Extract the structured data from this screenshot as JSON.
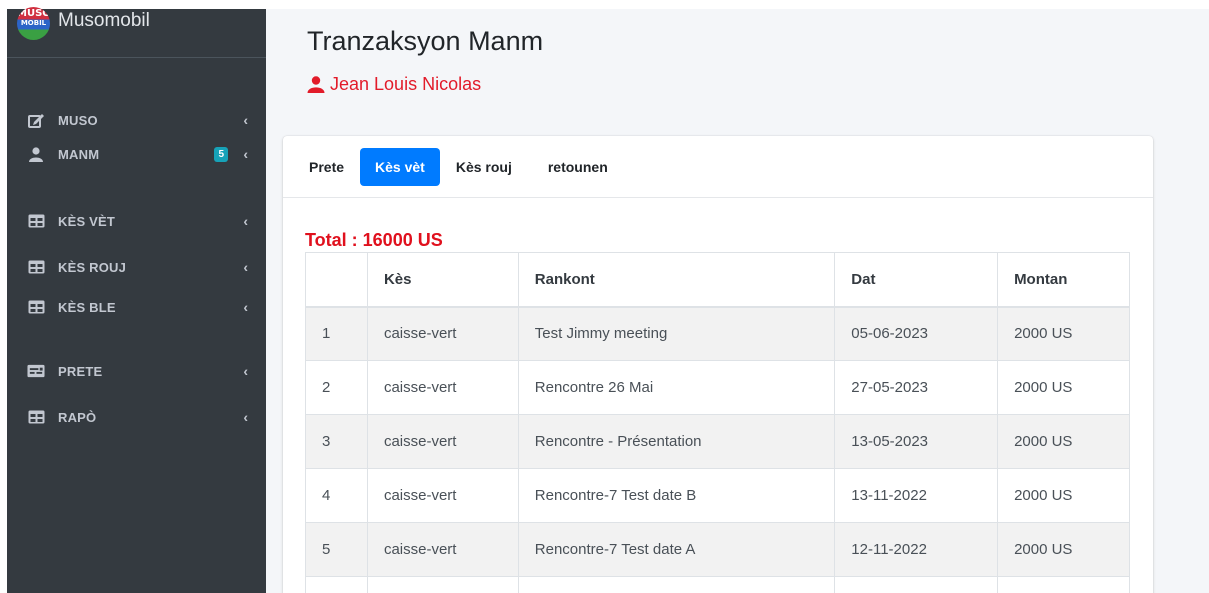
{
  "brand": {
    "logo_top": "MUSO",
    "logo_bottom": "MOBIL",
    "name": "Musomobil"
  },
  "sidebar": {
    "items": [
      {
        "label": "MUSO",
        "icon": "edit-icon"
      },
      {
        "label": "MANM",
        "icon": "user-icon",
        "badge": "5"
      },
      {
        "label": "KÈS VÈT",
        "icon": "table-icon"
      },
      {
        "label": "KÈS ROUJ",
        "icon": "table-icon"
      },
      {
        "label": "KÈS BLE",
        "icon": "table-icon"
      },
      {
        "label": "PRETE",
        "icon": "money-check-icon"
      },
      {
        "label": "RAPÒ",
        "icon": "table-icon"
      }
    ],
    "chevron": "‹"
  },
  "page": {
    "title": "Tranzaksyon Manm",
    "member_name": "Jean Louis Nicolas"
  },
  "tabs": [
    {
      "label": "Prete",
      "active": false
    },
    {
      "label": "Kès vèt",
      "active": true
    },
    {
      "label": "Kès rouj",
      "active": false
    },
    {
      "label": "retounen",
      "active": false
    }
  ],
  "total": "Total : 16000 US",
  "table": {
    "headers": [
      "",
      "Kès",
      "Rankont",
      "Dat",
      "Montan"
    ],
    "rows": [
      [
        "1",
        "caisse-vert",
        "Test Jimmy meeting",
        "05-06-2023",
        "2000 US"
      ],
      [
        "2",
        "caisse-vert",
        "Rencontre 26 Mai",
        "27-05-2023",
        "2000 US"
      ],
      [
        "3",
        "caisse-vert",
        "Rencontre - Présentation",
        "13-05-2023",
        "2000 US"
      ],
      [
        "4",
        "caisse-vert",
        "Rencontre-7 Test date B",
        "13-11-2022",
        "2000 US"
      ],
      [
        "5",
        "caisse-vert",
        "Rencontre-7 Test date A",
        "12-11-2022",
        "2000 US"
      ]
    ]
  },
  "colors": {
    "sidebar_bg": "#343a40",
    "accent": "#007bff",
    "danger": "#e21b2a",
    "badge": "#17a2b8"
  }
}
